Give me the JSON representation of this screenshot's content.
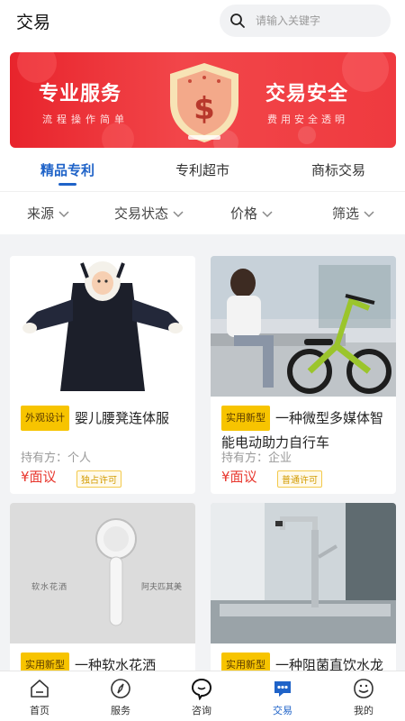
{
  "header": {
    "title": "交易",
    "search_placeholder": "请输入关键字"
  },
  "banner": {
    "left_title": "专业服务",
    "left_subtitle": "流程操作简单",
    "right_title": "交易安全",
    "right_subtitle": "费用安全透明",
    "shield_symbol": "$"
  },
  "tabs": [
    {
      "label": "精品专利",
      "active": true
    },
    {
      "label": "专利超市",
      "active": false
    },
    {
      "label": "商标交易",
      "active": false
    }
  ],
  "filters": [
    {
      "label": "来源"
    },
    {
      "label": "交易状态"
    },
    {
      "label": "价格"
    },
    {
      "label": "筛选"
    }
  ],
  "products": [
    {
      "badge": "外观设计",
      "name": "婴儿腰凳连体服",
      "holder": "持有方：个人",
      "price": "¥面议",
      "license": "独占许可"
    },
    {
      "badge": "实用新型",
      "name": "一种微型多媒体智能电动助力自行车",
      "holder": "持有方：企业",
      "price": "¥面议",
      "license": "普通许可"
    },
    {
      "badge": "实用新型",
      "name": "一种软水花洒",
      "image_caption_left": "软水花洒",
      "image_caption_right": "阿夫匹其美"
    },
    {
      "badge": "实用新型",
      "name": "一种阻菌直饮水龙"
    }
  ],
  "bottom_nav": [
    {
      "label": "首页",
      "icon": "home-icon",
      "active": false
    },
    {
      "label": "服务",
      "icon": "compass-icon",
      "active": false
    },
    {
      "label": "咨询",
      "icon": "chat-bubble-icon",
      "active": false
    },
    {
      "label": "交易",
      "icon": "trade-chat-icon",
      "active": true
    },
    {
      "label": "我的",
      "icon": "profile-icon",
      "active": false
    }
  ],
  "colors": {
    "accent": "#1f63c8",
    "price": "#e8382f",
    "badge": "#f7c400",
    "banner": "#e8242c"
  }
}
